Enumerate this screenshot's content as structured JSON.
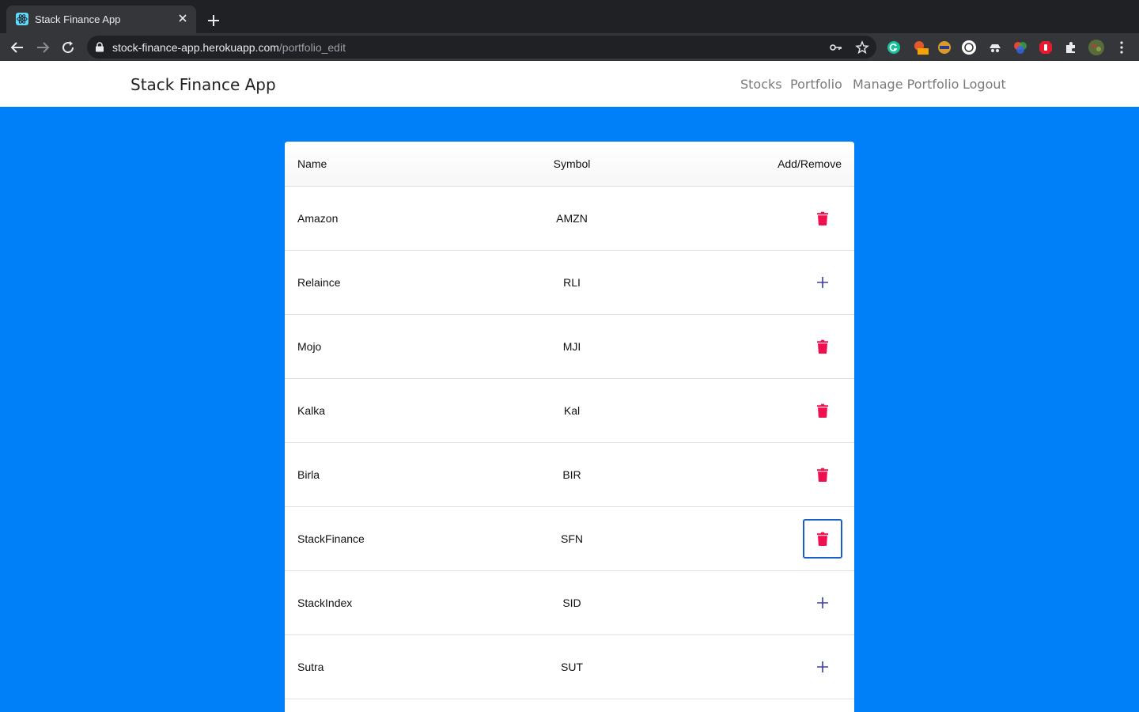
{
  "browser": {
    "tab_title": "Stack Finance App",
    "url_host": "stock-finance-app.herokuapp.com",
    "url_path": "/portfolio_edit"
  },
  "navbar": {
    "brand": "Stack Finance App",
    "links": [
      "Stocks",
      "Portfolio",
      "Manage Portfolio",
      "Logout"
    ]
  },
  "table": {
    "headers": {
      "name": "Name",
      "symbol": "Symbol",
      "action": "Add/Remove"
    },
    "rows": [
      {
        "name": "Amazon",
        "symbol": "AMZN",
        "action": "remove",
        "icon": "trash-icon"
      },
      {
        "name": "Relaince",
        "symbol": "RLI",
        "action": "add",
        "icon": "plus-icon"
      },
      {
        "name": "Mojo",
        "symbol": "MJI",
        "action": "remove",
        "icon": "trash-icon"
      },
      {
        "name": "Kalka",
        "symbol": "Kal",
        "action": "remove",
        "icon": "trash-icon"
      },
      {
        "name": "Birla",
        "symbol": "BIR",
        "action": "remove",
        "icon": "trash-icon"
      },
      {
        "name": "StackFinance",
        "symbol": "SFN",
        "action": "remove",
        "icon": "trash-icon",
        "focused": true
      },
      {
        "name": "StackIndex",
        "symbol": "SID",
        "action": "add",
        "icon": "plus-icon"
      },
      {
        "name": "Sutra",
        "symbol": "SUT",
        "action": "add",
        "icon": "plus-icon"
      }
    ]
  },
  "colors": {
    "page_bg": "#0080f8",
    "remove": "#f0104e",
    "add": "#3a3aa8",
    "focus": "#1a5fc8"
  }
}
